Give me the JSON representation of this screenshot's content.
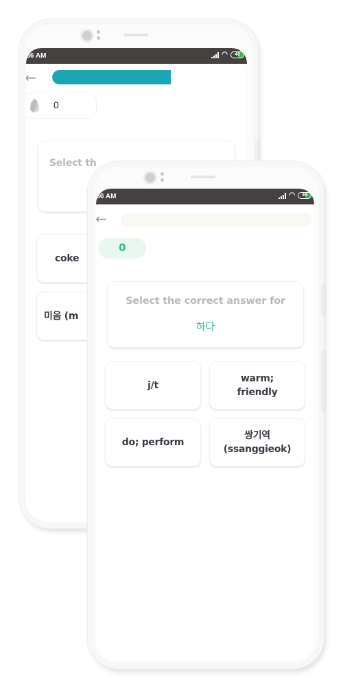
{
  "colors": {
    "progress_fill_back": "#1aa6b7",
    "progress_track_front": "#f8f9f3",
    "accent_green": "#2ec27e",
    "score_pill_bg": "#eaf7ee",
    "status_bar": "#454141",
    "question_text": "#b9b9b9",
    "answer_text": "#3b3b45"
  },
  "back_screen": {
    "status_bar": {
      "time": ":36 AM",
      "battery": "46"
    },
    "progress": {
      "value_percent": 66
    },
    "score": {
      "icon": "gem-stone-icon",
      "value": "0"
    },
    "question": {
      "prompt_visible": "Select th"
    },
    "answers": [
      {
        "label": "coke"
      },
      {
        "label": "미음 (m"
      }
    ]
  },
  "front_screen": {
    "status_bar": {
      "time": ":36 AM",
      "battery": "46"
    },
    "progress": {
      "value_percent": 0
    },
    "score": {
      "value": "0"
    },
    "question": {
      "prompt": "Select the correct answer for",
      "word": "하다"
    },
    "answers": [
      {
        "label": "j/t"
      },
      {
        "label": "warm; friendly"
      },
      {
        "label": "do; perform"
      },
      {
        "label": "쌍기역 (ssanggieok)"
      }
    ]
  }
}
